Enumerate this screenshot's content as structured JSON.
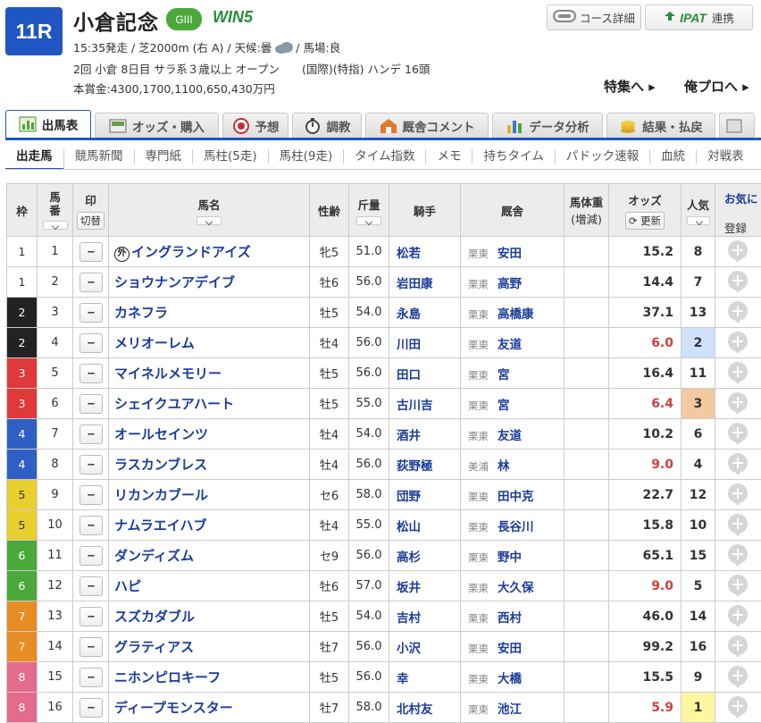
{
  "header": {
    "race_number": "11R",
    "race_name": "小倉記念",
    "grade": "GIII",
    "win5": "WIN5",
    "race_info_1_pre": "15:35発走 / 芝2000m (右 A) / 天候:曇",
    "race_info_1_post": "/ 馬場:良",
    "race_info_2": "2回 小倉 8日目 サラ系３歳以上 オープン　　(国際)(特指) ハンデ 16頭",
    "race_info_3": "本賞金:4300,1700,1100,650,430万円",
    "course_button": "コース詳細",
    "ipat_logo": "IPAT",
    "ipat_button": "連携",
    "special_link": "特集へ ▸",
    "pro_link": "俺プロへ ▸"
  },
  "main_tabs": [
    {
      "label": "出馬表",
      "icon": "entry-table-icon"
    },
    {
      "label": "オッズ・購入",
      "icon": "odds-icon"
    },
    {
      "label": "予想",
      "icon": "target-icon"
    },
    {
      "label": "調教",
      "icon": "stopwatch-icon"
    },
    {
      "label": "厩舎コメント",
      "icon": "stable-icon"
    },
    {
      "label": "データ分析",
      "icon": "bar-chart-icon"
    },
    {
      "label": "結果・払戻",
      "icon": "coins-icon"
    }
  ],
  "sub_tabs": [
    "出走馬",
    "競馬新聞",
    "専門紙",
    "馬柱(5走)",
    "馬柱(9走)",
    "タイム指数",
    "メモ",
    "持ちタイム",
    "パドック速報",
    "血統",
    "対戦表"
  ],
  "table": {
    "headers": {
      "waku": "枠",
      "umaban": "馬番",
      "mark": "印",
      "mark_toggle": "切替",
      "name": "馬名",
      "sex_age": "性齢",
      "weight": "斤量",
      "jockey": "騎手",
      "stable": "厩舎",
      "body_weight": "馬体重",
      "body_weight_sub": "(増減)",
      "odds": "オッズ",
      "odds_refresh": "更新",
      "popularity": "人気",
      "favorite": "お気に",
      "register": "登録"
    },
    "mark_placeholder": "--",
    "rows": [
      {
        "waku": "1",
        "num": "1",
        "name": "イングランドアイズ",
        "foreign": "外",
        "sex": "牝5",
        "weight": "51.0",
        "jockey": "松若",
        "loc": "栗東",
        "trainer": "安田",
        "odds": "15.2",
        "pop": "8"
      },
      {
        "waku": "1",
        "num": "2",
        "name": "ショウナンアデイブ",
        "sex": "牡6",
        "weight": "56.0",
        "jockey": "岩田康",
        "loc": "栗東",
        "trainer": "高野",
        "odds": "14.4",
        "pop": "7"
      },
      {
        "waku": "2",
        "num": "3",
        "name": "カネフラ",
        "sex": "牡5",
        "weight": "54.0",
        "jockey": "永島",
        "loc": "栗東",
        "trainer": "高橋康",
        "odds": "37.1",
        "pop": "13"
      },
      {
        "waku": "2",
        "num": "4",
        "name": "メリオーレム",
        "sex": "牡4",
        "weight": "56.0",
        "jockey": "川田",
        "loc": "栗東",
        "trainer": "友道",
        "odds": "6.0",
        "pop": "2"
      },
      {
        "waku": "3",
        "num": "5",
        "name": "マイネルメモリー",
        "sex": "牡5",
        "weight": "56.0",
        "jockey": "田口",
        "loc": "栗東",
        "trainer": "宮",
        "odds": "16.4",
        "pop": "11"
      },
      {
        "waku": "3",
        "num": "6",
        "name": "シェイクユアハート",
        "sex": "牡5",
        "weight": "55.0",
        "jockey": "古川吉",
        "loc": "栗東",
        "trainer": "宮",
        "odds": "6.4",
        "pop": "3"
      },
      {
        "waku": "4",
        "num": "7",
        "name": "オールセインツ",
        "sex": "牡4",
        "weight": "54.0",
        "jockey": "酒井",
        "loc": "栗東",
        "trainer": "友道",
        "odds": "10.2",
        "pop": "6"
      },
      {
        "waku": "4",
        "num": "8",
        "name": "ラスカンブレス",
        "sex": "牡4",
        "weight": "56.0",
        "jockey": "荻野極",
        "loc": "美浦",
        "trainer": "林",
        "odds": "9.0",
        "pop": "4"
      },
      {
        "waku": "5",
        "num": "9",
        "name": "リカンカブール",
        "sex": "セ6",
        "weight": "58.0",
        "jockey": "団野",
        "loc": "栗東",
        "trainer": "田中克",
        "odds": "22.7",
        "pop": "12"
      },
      {
        "waku": "5",
        "num": "10",
        "name": "ナムラエイハブ",
        "sex": "牡4",
        "weight": "55.0",
        "jockey": "松山",
        "loc": "栗東",
        "trainer": "長谷川",
        "odds": "15.8",
        "pop": "10"
      },
      {
        "waku": "6",
        "num": "11",
        "name": "ダンディズム",
        "sex": "セ9",
        "weight": "56.0",
        "jockey": "高杉",
        "loc": "栗東",
        "trainer": "野中",
        "odds": "65.1",
        "pop": "15"
      },
      {
        "waku": "6",
        "num": "12",
        "name": "ハピ",
        "sex": "牡6",
        "weight": "57.0",
        "jockey": "坂井",
        "loc": "栗東",
        "trainer": "大久保",
        "odds": "9.0",
        "pop": "5"
      },
      {
        "waku": "7",
        "num": "13",
        "name": "スズカダブル",
        "sex": "牡5",
        "weight": "54.0",
        "jockey": "吉村",
        "loc": "栗東",
        "trainer": "西村",
        "odds": "46.0",
        "pop": "14"
      },
      {
        "waku": "7",
        "num": "14",
        "name": "グラティアス",
        "sex": "牡7",
        "weight": "56.0",
        "jockey": "小沢",
        "loc": "栗東",
        "trainer": "安田",
        "odds": "99.2",
        "pop": "16"
      },
      {
        "waku": "8",
        "num": "15",
        "name": "ニホンピロキーフ",
        "sex": "牡5",
        "weight": "56.0",
        "jockey": "幸",
        "loc": "栗東",
        "trainer": "大橋",
        "odds": "15.5",
        "pop": "9"
      },
      {
        "waku": "8",
        "num": "16",
        "name": "ディープモンスター",
        "sex": "牡7",
        "weight": "58.0",
        "jockey": "北村友",
        "loc": "栗東",
        "trainer": "池江",
        "odds": "5.9",
        "pop": "1"
      }
    ]
  },
  "colors": {
    "accent": "#1f56c2",
    "waku": {
      "1": "#ffffff",
      "2": "#222222",
      "3": "#e0393a",
      "4": "#2f5fc4",
      "5": "#e8cf2f",
      "6": "#4aa93a",
      "7": "#e88c24",
      "8": "#e56b8c"
    },
    "pop1": "#fff7a0",
    "pop2": "#cfe0fb",
    "pop3": "#f4c8a0",
    "odds_low": "#d0403a"
  }
}
